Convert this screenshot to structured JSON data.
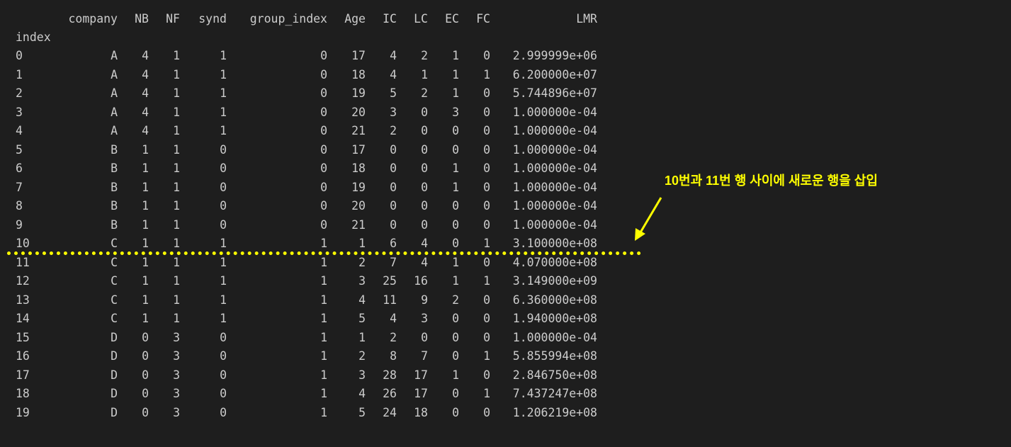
{
  "table": {
    "columns": [
      "company",
      "NB",
      "NF",
      "synd",
      "group_index",
      "Age",
      "IC",
      "LC",
      "EC",
      "FC",
      "LMR"
    ],
    "index_name": "index",
    "rows": [
      [
        "0",
        "A",
        "4",
        "1",
        "1",
        "0",
        "17",
        "4",
        "2",
        "1",
        "0",
        "2.999999e+06"
      ],
      [
        "1",
        "A",
        "4",
        "1",
        "1",
        "0",
        "18",
        "4",
        "1",
        "1",
        "1",
        "6.200000e+07"
      ],
      [
        "2",
        "A",
        "4",
        "1",
        "1",
        "0",
        "19",
        "5",
        "2",
        "1",
        "0",
        "5.744896e+07"
      ],
      [
        "3",
        "A",
        "4",
        "1",
        "1",
        "0",
        "20",
        "3",
        "0",
        "3",
        "0",
        "1.000000e-04"
      ],
      [
        "4",
        "A",
        "4",
        "1",
        "1",
        "0",
        "21",
        "2",
        "0",
        "0",
        "0",
        "1.000000e-04"
      ],
      [
        "5",
        "B",
        "1",
        "1",
        "0",
        "0",
        "17",
        "0",
        "0",
        "0",
        "0",
        "1.000000e-04"
      ],
      [
        "6",
        "B",
        "1",
        "1",
        "0",
        "0",
        "18",
        "0",
        "0",
        "1",
        "0",
        "1.000000e-04"
      ],
      [
        "7",
        "B",
        "1",
        "1",
        "0",
        "0",
        "19",
        "0",
        "0",
        "1",
        "0",
        "1.000000e-04"
      ],
      [
        "8",
        "B",
        "1",
        "1",
        "0",
        "0",
        "20",
        "0",
        "0",
        "0",
        "0",
        "1.000000e-04"
      ],
      [
        "9",
        "B",
        "1",
        "1",
        "0",
        "0",
        "21",
        "0",
        "0",
        "0",
        "0",
        "1.000000e-04"
      ],
      [
        "10",
        "C",
        "1",
        "1",
        "1",
        "1",
        "1",
        "6",
        "4",
        "0",
        "1",
        "3.100000e+08"
      ],
      [
        "11",
        "C",
        "1",
        "1",
        "1",
        "1",
        "2",
        "7",
        "4",
        "1",
        "0",
        "4.070000e+08"
      ],
      [
        "12",
        "C",
        "1",
        "1",
        "1",
        "1",
        "3",
        "25",
        "16",
        "1",
        "1",
        "3.149000e+09"
      ],
      [
        "13",
        "C",
        "1",
        "1",
        "1",
        "1",
        "4",
        "11",
        "9",
        "2",
        "0",
        "6.360000e+08"
      ],
      [
        "14",
        "C",
        "1",
        "1",
        "1",
        "1",
        "5",
        "4",
        "3",
        "0",
        "0",
        "1.940000e+08"
      ],
      [
        "15",
        "D",
        "0",
        "3",
        "0",
        "1",
        "1",
        "2",
        "0",
        "0",
        "0",
        "1.000000e-04"
      ],
      [
        "16",
        "D",
        "0",
        "3",
        "0",
        "1",
        "2",
        "8",
        "7",
        "0",
        "1",
        "5.855994e+08"
      ],
      [
        "17",
        "D",
        "0",
        "3",
        "0",
        "1",
        "3",
        "28",
        "17",
        "1",
        "0",
        "2.846750e+08"
      ],
      [
        "18",
        "D",
        "0",
        "3",
        "0",
        "1",
        "4",
        "26",
        "17",
        "0",
        "1",
        "7.437247e+08"
      ],
      [
        "19",
        "D",
        "0",
        "3",
        "0",
        "1",
        "5",
        "24",
        "18",
        "0",
        "0",
        "1.206219e+08"
      ]
    ]
  },
  "annotation": {
    "text": "10번과 11번 행 사이에 새로운 행을 삽입",
    "color": "#ffff00"
  },
  "colors": {
    "background": "#1e1e1e",
    "text": "#cccccc",
    "highlight": "#ffff00"
  }
}
